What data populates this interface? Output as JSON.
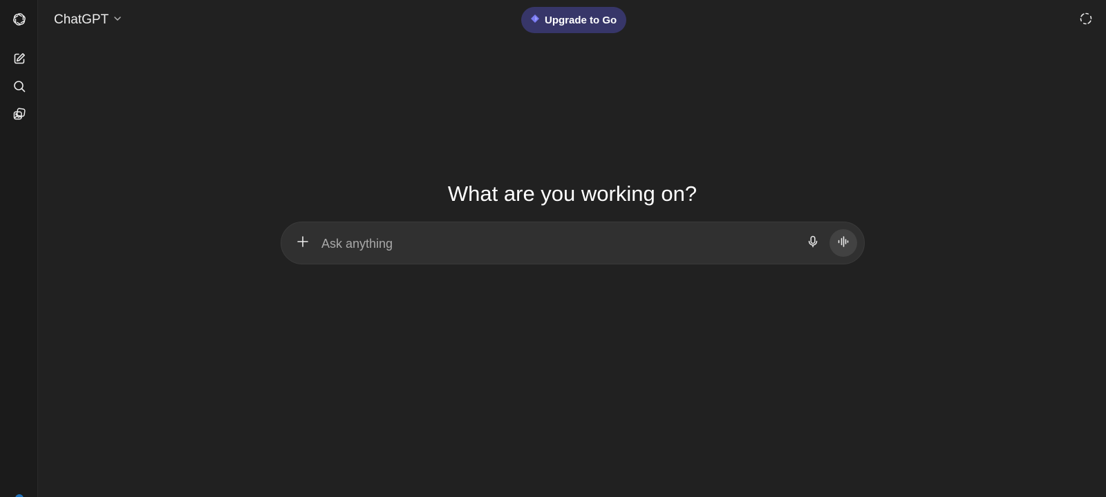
{
  "app": {
    "title": "ChatGPT"
  },
  "header": {
    "model_name": "ChatGPT",
    "upgrade_label": "Upgrade to Go",
    "upgrade_color": "#373669",
    "upgrade_icon_color": "#7a7bf2"
  },
  "sidebar": {
    "items": [
      {
        "icon": "openai-logo-icon"
      },
      {
        "icon": "new-chat-icon"
      },
      {
        "icon": "search-icon"
      },
      {
        "icon": "library-icon"
      }
    ]
  },
  "main": {
    "heading": "What are you working on?"
  },
  "composer": {
    "placeholder": "Ask anything",
    "value": "",
    "icons": [
      "plus-icon",
      "microphone-icon",
      "voice-mode-icon"
    ]
  },
  "colors": {
    "background": "#212121",
    "sidebar": "#1b1b1b",
    "composer": "#303030",
    "voice_button": "#424242"
  }
}
